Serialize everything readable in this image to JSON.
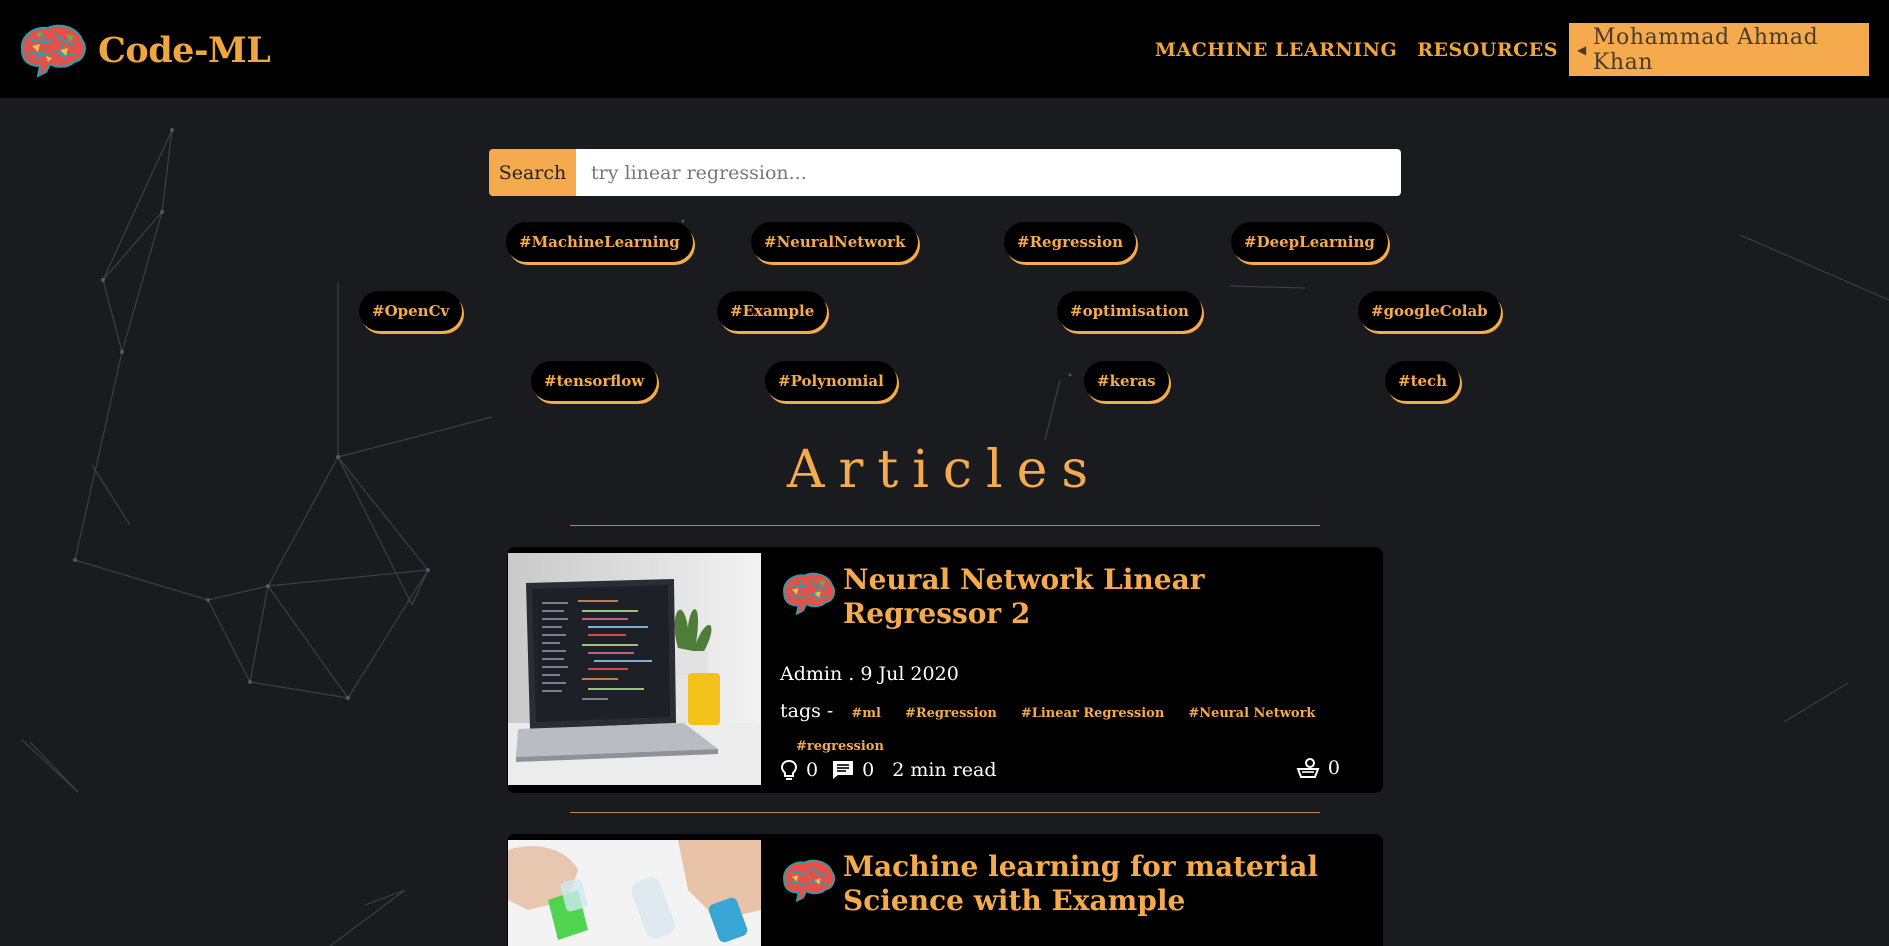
{
  "brand": {
    "name": "Code-ML"
  },
  "nav": {
    "links": [
      "MACHINE LEARNING",
      "RESOURCES"
    ],
    "user_name": "Mohammad Ahmad Khan"
  },
  "search": {
    "button_label": "Search",
    "placeholder": "try linear regression..."
  },
  "hashtags": [
    "#MachineLearning",
    "#NeuralNetwork",
    "#Regression",
    "#DeepLearning",
    "#OpenCv",
    "#Example",
    "#optimisation",
    "#googleColab",
    "#tensorflow",
    "#Polynomial",
    "#keras",
    "#tech"
  ],
  "section_title": "Articles",
  "articles": [
    {
      "title": "Neural Network Linear Regressor 2",
      "meta": "Admin . 9 Jul 2020",
      "tags_label": "tags -",
      "tags": [
        "#ml",
        "#Regression",
        "#Linear Regression",
        "#Neural Network",
        "#regression"
      ],
      "likes": "0",
      "comments": "0",
      "read_time": "2 min read",
      "views": "0"
    },
    {
      "title": "Machine learning for material Science with Example"
    }
  ],
  "colors": {
    "accent": "#f4aa4d",
    "nav_bg": "#000000",
    "page_bg": "#1a1b1f"
  }
}
